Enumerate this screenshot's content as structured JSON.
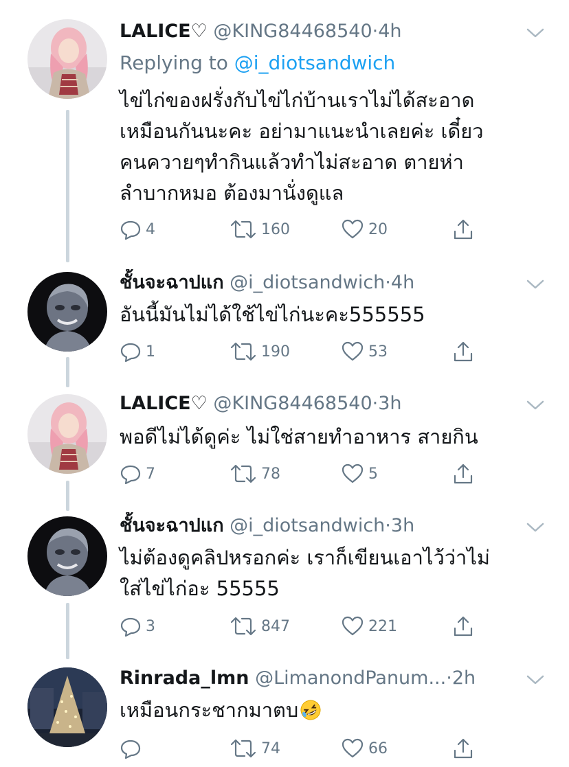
{
  "tweets": [
    {
      "name": "LALICE♡",
      "handle": "@KING84468540",
      "time": "4h",
      "replying_label": "Replying to",
      "replying_handle": "@i_diotsandwich",
      "text": "ไข่ไก่ของฝรั่งกับไข่ไก่บ้านเราไม่ได้สะอาด\nเหมือนกันนะคะ อย่ามาแนะนำเลยค่ะ เดี๋ยว\nคนควายๆทำกินแล้วทำไม่สะอาด ตายห่า\nลำบากหมอ ต้องมานั่งดูแล",
      "replies": "4",
      "retweets": "160",
      "likes": "20"
    },
    {
      "name": "ชั้นจะฉาปแก",
      "handle": "@i_diotsandwich",
      "time": "4h",
      "text": "อันนี้มันไม่ได้ใช้ไข่ไก่นะคะ555555",
      "replies": "1",
      "retweets": "190",
      "likes": "53"
    },
    {
      "name": "LALICE♡",
      "handle": "@KING84468540",
      "time": "3h",
      "text": "พอดีไม่ได้ดูค่ะ ไม่ใช่สายทำอาหาร สายกิน",
      "replies": "7",
      "retweets": "78",
      "likes": "5"
    },
    {
      "name": "ชั้นจะฉาปแก",
      "handle": "@i_diotsandwich",
      "time": "3h",
      "text": "ไม่ต้องดูคลิปหรอกค่ะ เราก็เขียนเอาไว้ว่าไม่\nใส่ไข่ไก่อะ 55555",
      "replies": "3",
      "retweets": "847",
      "likes": "221"
    },
    {
      "name": "Rinrada_lmn",
      "handle": "@LimanondPanum...",
      "time": "2h",
      "text": "เหมือนกระชากมาตบ",
      "replies": "",
      "retweets": "74",
      "likes": "66"
    }
  ],
  "separator": "·",
  "icons": {
    "reply": "reply-icon",
    "retweet": "retweet-icon",
    "like": "heart-icon",
    "share": "share-icon",
    "caret": "chevron-down-icon",
    "emoji": "rolling-on-floor-laughing-emoji"
  },
  "colors": {
    "text": "#14171a",
    "secondary": "#657786",
    "link": "#1da1f2",
    "thread_line": "#ccd6dd"
  }
}
